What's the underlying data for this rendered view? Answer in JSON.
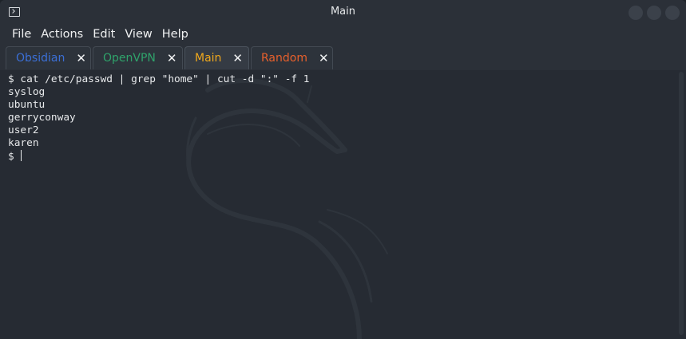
{
  "window": {
    "title": "Main"
  },
  "menu": {
    "items": [
      "File",
      "Actions",
      "Edit",
      "View",
      "Help"
    ]
  },
  "tabs": [
    {
      "label": "Obsidian",
      "color": "#3b6fd6"
    },
    {
      "label": "OpenVPN",
      "color": "#2fa36b"
    },
    {
      "label": "Main",
      "color": "#f0a81c",
      "active": true
    },
    {
      "label": "Random",
      "color": "#e8602c"
    }
  ],
  "tab_close_glyph": "✕",
  "terminal": {
    "lines": [
      "$ cat /etc/passwd | grep \"home\" | cut -d \":\" -f 1",
      "syslog",
      "ubuntu",
      "gerryconway",
      "user2",
      "karen"
    ],
    "prompt": "$ "
  },
  "icons": {
    "app": "terminal-icon",
    "background": "kali-dragon-logo"
  }
}
